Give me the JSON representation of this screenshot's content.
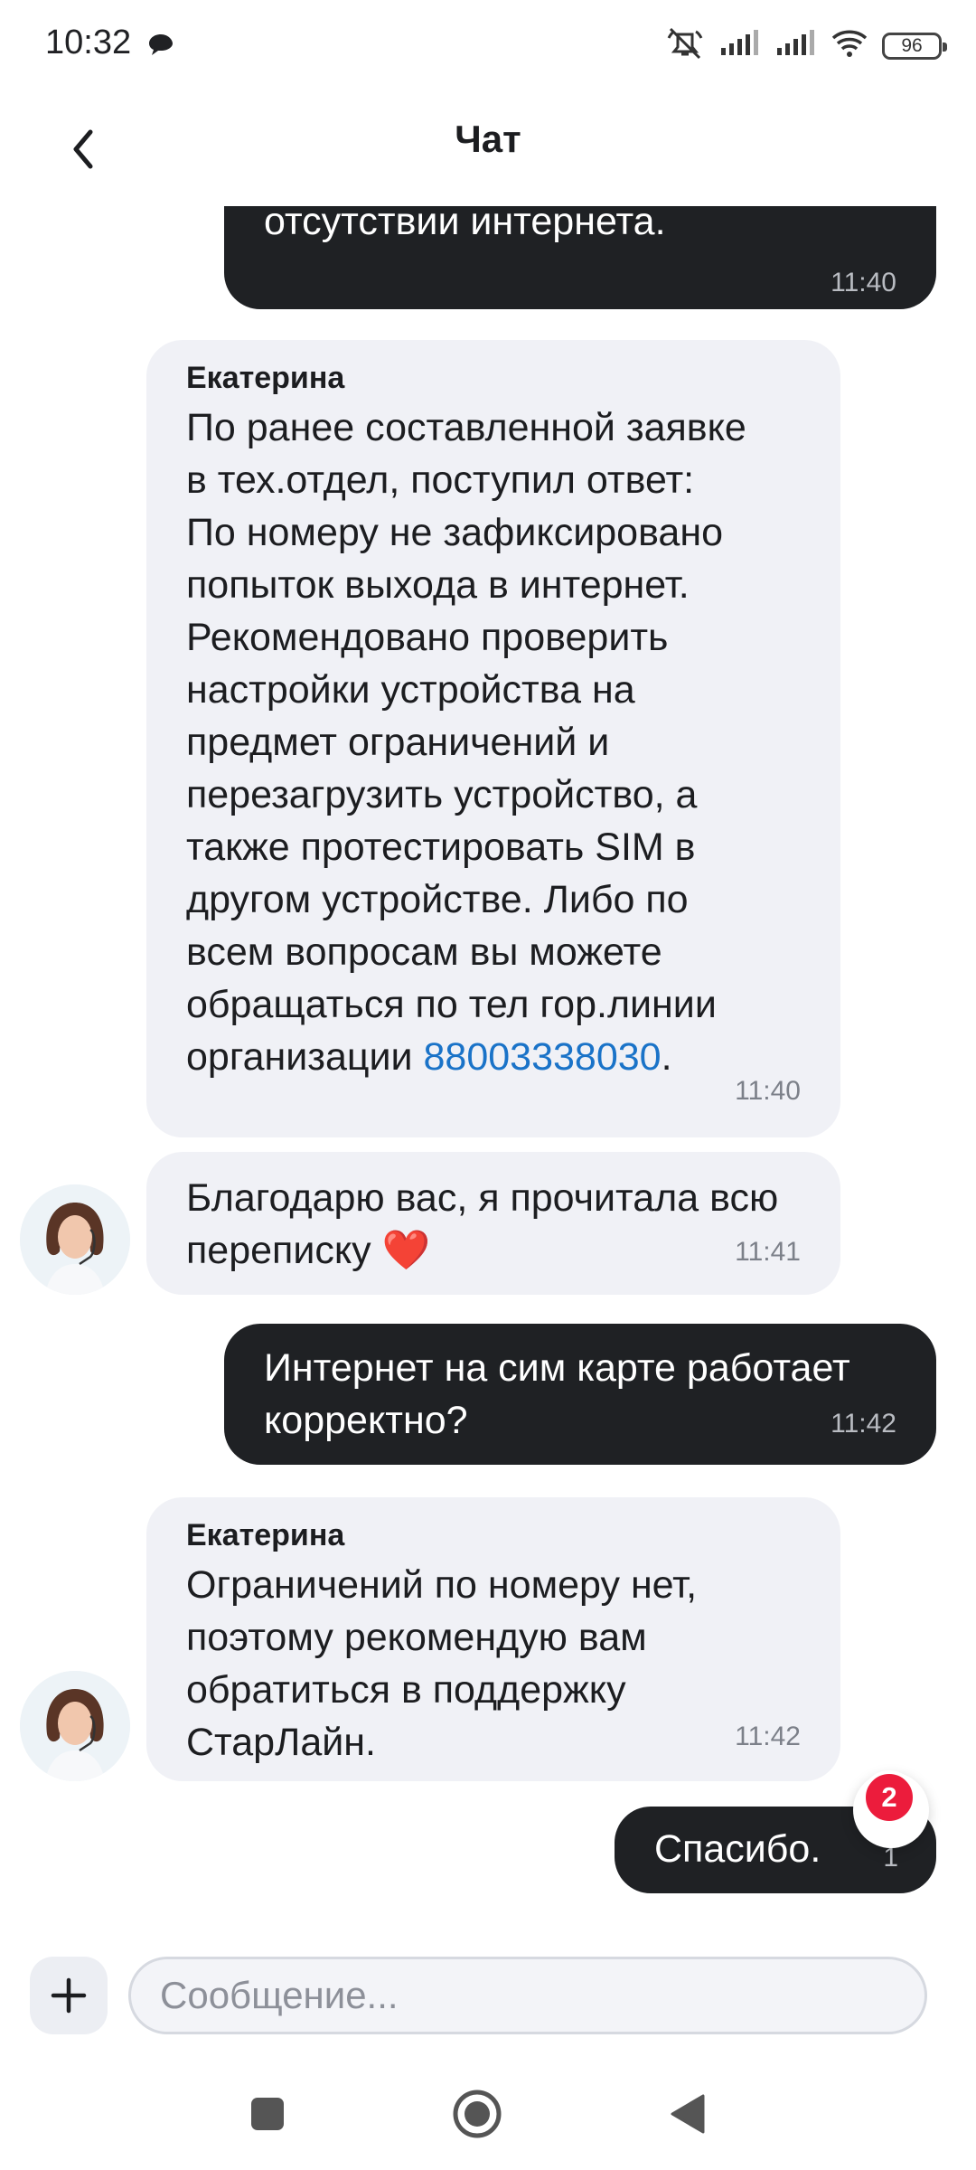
{
  "status_bar": {
    "time": "10:32",
    "battery": "96"
  },
  "header": {
    "title": "Чат"
  },
  "messages": [
    {
      "side": "out",
      "text": "единственная проблема в\nотсутствии интернета.",
      "time": "11:40"
    },
    {
      "side": "in",
      "sender": "Екатерина",
      "text": "По ранее составленной заявке\nв тех.отдел, поступил ответ:\nПо номеру не зафиксировано\nпопыток выхода в интернет.\nРекомендовано проверить\nнастройки устройства на\nпредмет ограничений и\nперезагрузить устройство, а\nтакже протестировать SIM в\nдругом устройстве. Либо по\nвсем вопросам вы можете\nобращаться по тел гор.линии\nорганизации ",
      "phone": "88003338030",
      "suffix": ".",
      "time": "11:40"
    },
    {
      "side": "in",
      "text": "Благодарю вас, я прочитала всю\nпереписку ❤️",
      "time": "11:41"
    },
    {
      "side": "out",
      "text": "Интернет на сим карте работает\nкорректно?",
      "time": "11:42"
    },
    {
      "side": "in",
      "sender": "Екатерина",
      "text": "Ограничений по номеру нет,\nпоэтому рекомендую вам\nобратиться в поддержку\nСтарЛайн.",
      "time": "11:42"
    },
    {
      "side": "out",
      "text": "Спасибо.",
      "time": "1"
    }
  ],
  "scroll_badge": "2",
  "input": {
    "placeholder": "Сообщение..."
  },
  "icons": {
    "back": "chevron-left-icon",
    "attach": "plus-icon",
    "scroll_down": "chevron-down-icon",
    "nav_recent": "square-icon",
    "nav_home": "circle-icon",
    "nav_back": "triangle-icon"
  },
  "colors": {
    "outgoing_bubble": "#1f2124",
    "incoming_bubble": "#f0f1f6",
    "link": "#1a73c8",
    "badge": "#ec1c3c"
  }
}
